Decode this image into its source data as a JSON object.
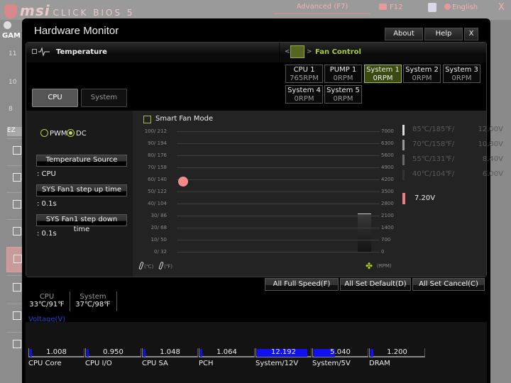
{
  "background": {
    "brand": "msi",
    "product": "CLICK BIOS 5",
    "mode_button": "Advanced (F7)",
    "screenshot_key": "F12",
    "language": "English",
    "close": "X",
    "game_label": "GAM",
    "sidebar_numbers": [
      "11",
      "10",
      "8"
    ],
    "ez_label": "EZ"
  },
  "window": {
    "title": "Hardware Monitor",
    "buttons": {
      "about": "About",
      "help": "Help",
      "close": "X"
    }
  },
  "temperature": {
    "title": "Temperature",
    "tabs": [
      {
        "label": "CPU",
        "active": true
      },
      {
        "label": "System",
        "active": false
      }
    ]
  },
  "fan_control": {
    "title": "Fan Control",
    "prev": "<",
    "next": ">",
    "fans": [
      {
        "name": "CPU 1",
        "rpm": "765RPM",
        "active": false
      },
      {
        "name": "PUMP 1",
        "rpm": "0RPM",
        "active": false
      },
      {
        "name": "System 1",
        "rpm": "0RPM",
        "active": true
      },
      {
        "name": "System 2",
        "rpm": "0RPM",
        "active": false
      },
      {
        "name": "System 3",
        "rpm": "0RPM",
        "active": false
      },
      {
        "name": "System 4",
        "rpm": "0RPM",
        "active": false
      },
      {
        "name": "System 5",
        "rpm": "0RPM",
        "active": false
      }
    ]
  },
  "mode": {
    "pwm": "PWM",
    "dc": "DC",
    "selected": "DC"
  },
  "settings": [
    {
      "button": "Temperature Source",
      "value": ": CPU"
    },
    {
      "button": "SYS Fan1 step up time",
      "value": ": 0.1s"
    },
    {
      "button": "SYS Fan1 step down time",
      "value": ": 0.1s"
    }
  ],
  "graph": {
    "smart_fan_label": "Smart Fan Mode",
    "smart_fan_checked": false,
    "temp_ticks": [
      "100/ 212",
      "90/ 194",
      "80/ 176",
      "70/ 158",
      "60/ 140",
      "50/ 122",
      "40/ 104",
      "30/  86",
      "20/  68",
      "10/  50",
      "0/  32"
    ],
    "rpm_ticks": [
      "7000",
      "6300",
      "5600",
      "4900",
      "4200",
      "3500",
      "2800",
      "2100",
      "1400",
      "700",
      "0"
    ],
    "celsius_unit": "(℃)",
    "fahrenheit_unit": "(℉)",
    "rpm_unit": "(RPM)",
    "current_temp_c": 58,
    "current_rpm_fraction": 0.3
  },
  "voltage_levels": [
    {
      "temp": "85℃/185℉/",
      "volt": "12.00V",
      "color": "#dddddd"
    },
    {
      "temp": "70℃/158℉/",
      "volt": "10.80V",
      "color": "#9a9a9a"
    },
    {
      "temp": "55℃/131℉/",
      "volt": "8.40V",
      "color": "#6a6a6a"
    },
    {
      "temp": "40℃/104℉/",
      "volt": "6.00V",
      "color": "#333333"
    }
  ],
  "current_voltage": "7.20V",
  "actions": {
    "full_speed": "All Full Speed(F)",
    "set_default": "All Set Default(D)",
    "set_cancel": "All Set Cancel(C)"
  },
  "temps": [
    {
      "label": "CPU",
      "value": "33℃/91℉"
    },
    {
      "label": "System",
      "value": "37℃/98℉"
    }
  ],
  "voltage": {
    "title": "Voltage(V)",
    "rails": [
      {
        "label": "CPU Core",
        "value": "1.008",
        "fill": 0.04
      },
      {
        "label": "CPU I/O",
        "value": "0.950",
        "fill": 0.04
      },
      {
        "label": "CPU SA",
        "value": "1.048",
        "fill": 0.04
      },
      {
        "label": "PCH",
        "value": "1.064",
        "fill": 0.04
      },
      {
        "label": "System/12V",
        "value": "12.192",
        "fill": 0.95
      },
      {
        "label": "System/5V",
        "value": "5.040",
        "fill": 0.4
      },
      {
        "label": "DRAM",
        "value": "1.200",
        "fill": 0.05
      }
    ]
  }
}
